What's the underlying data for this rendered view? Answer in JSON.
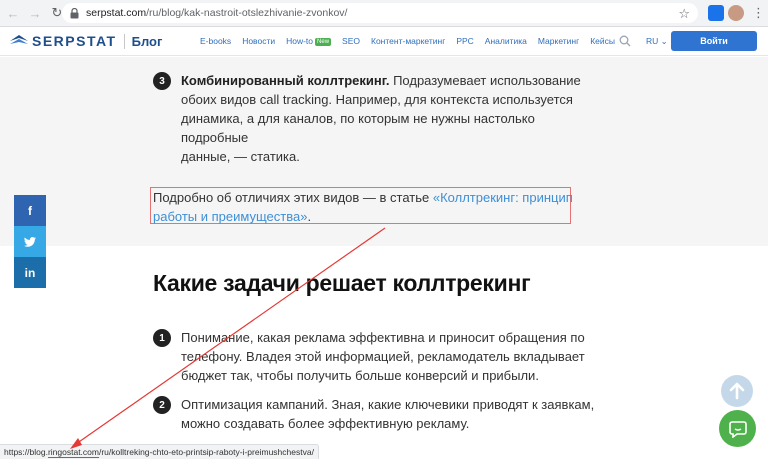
{
  "browser": {
    "url_host": "serpstat.com",
    "url_path": "/ru/blog/kak-nastroit-otslezhivanie-zvonkov/",
    "status_url_prefix": "https://blog.",
    "status_url_highlight": "ringostat.com",
    "status_url_suffix": "/ru/kolltreking-chto-eto-printsip-raboty-i-preimushchestva/"
  },
  "site": {
    "logo_text": "SERPSTAT",
    "blog_label": "Блог",
    "menu": [
      "E-books",
      "Новости",
      "How-to",
      "SEO",
      "Контент-маркетинг",
      "PPC",
      "Аналитика",
      "Маркетинг",
      "Кейсы"
    ],
    "new_badge": "New",
    "lang": "RU",
    "login_label": "Войти",
    "brand_color": "#1f4e8c",
    "accent_color": "#2f74d0"
  },
  "article": {
    "item3_number": "3",
    "item3_bold": "Комбинированный коллтрекинг.",
    "item3_lines": [
      "Подразумевает использование",
      "обоих видов call tracking. Например, для контекста используется",
      "динамика, а для каналов, по которым не нужны настолько подробные",
      "данные, — статика."
    ],
    "callout_text": "Подробно об отличиях этих видов — в статье ",
    "callout_link_line1": "«Коллтрекинг: принцип",
    "callout_link_line2": "работы и преимущества»",
    "callout_end": ".",
    "heading": "Какие задачи решает коллтрекинг",
    "item1_number": "1",
    "item1_lines": [
      "Понимание, какая реклама эффективна и приносит обращения по",
      "телефону. Владея этой информацией, рекламодатель вкладывает",
      "бюджет так, чтобы получить больше конверсий и прибыли."
    ],
    "item2_number": "2",
    "item2_lines": [
      "Оптимизация кампаний. Зная, какие ключевики приводят к заявкам,",
      "можно создавать более эффективную рекламу."
    ]
  },
  "share": {
    "facebook_label": "f",
    "twitter_icon": "twitter-icon",
    "linkedin_label": "in"
  },
  "icons": {
    "back": "arrow-left-icon",
    "forward": "arrow-right-icon",
    "reload": "reload-icon",
    "lock": "lock-icon",
    "star": "star-icon",
    "search": "search-icon",
    "scroll_up": "arrow-up-icon",
    "chat": "chat-icon"
  }
}
